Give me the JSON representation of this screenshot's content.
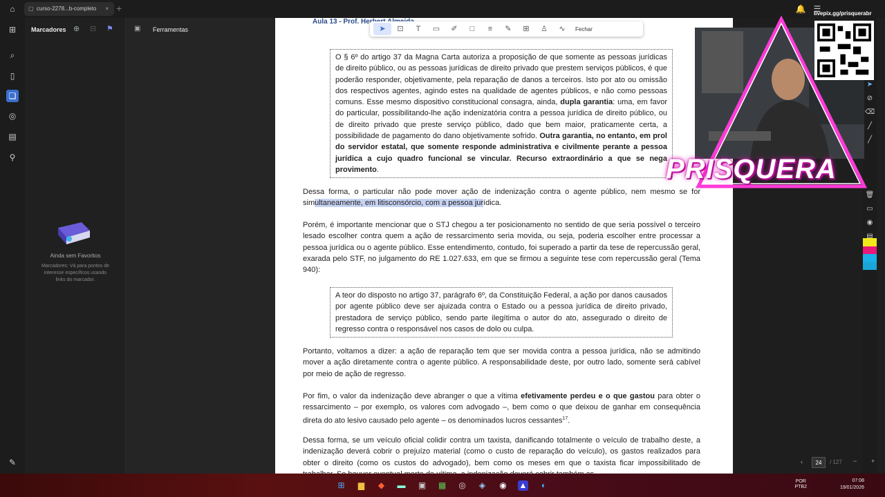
{
  "window": {
    "tab_title": "curso-2278...b-completo"
  },
  "bookmarks": {
    "title": "Marcadores",
    "empty_title": "Ainda sem Favoritos",
    "empty_desc": "Marcadores: Vá para pontos de interesse específicos usando links do marcador."
  },
  "tools_panel": {
    "title": "Ferramentas"
  },
  "float_toolbar": {
    "close_label": "Fechar"
  },
  "doc": {
    "header": "Aula 13 - Prof. Herbert Almeida",
    "box1_pre": "O § 6º do artigo 37 da Magna Carta autoriza a proposição de que somente as pessoas jurídicas de direito público, ou as pessoas jurídicas de direito privado que prestem serviços públicos, é que poderão responder, objetivamente, pela reparação de danos a terceiros. Isto por ato ou omissão dos respectivos agentes, agindo estes na qualidade de agentes públicos, e não como pessoas comuns. Esse mesmo dispositivo constitucional consagra, ainda, ",
    "box1_bold1": "dupla garantia",
    "box1_mid": ": uma, em favor do particular, possibilitando-lhe ação indenizatória contra a pessoa jurídica de direito público, ou de direito privado que preste serviço público, dado que bem maior, praticamente certa, a possibilidade de pagamento do dano objetivamente sofrido. ",
    "box1_bold2": "Outra garantia, no entanto, em prol do servidor estatal, que somente responde administrativa e civilmente perante a pessoa jurídica a cujo quadro funcional se vincular. Recurso extraordinário a que se nega provimento",
    "box1_end": ".",
    "p1_pre": "Dessa forma, o particular não pode mover ação de indenização contra o agente público, nem mesmo se for sim",
    "p1_sel": "ultaneamente, em litisconsórcio, com a pessoa jur",
    "p1_post": "ídica.",
    "p2": "Porém, é importante mencionar que o STJ chegou a ter posicionamento no sentido de que seria possível o terceiro lesado escolher contra quem a ação de ressarcimento seria movida, ou seja, poderia escolher entre processar a pessoa jurídica ou o agente público. Esse entendimento, contudo, foi superado a partir da tese de repercussão geral, exarada pelo STF, no julgamento do RE 1.027.633, em que se firmou a seguinte tese com repercussão geral (Tema 940):",
    "box2": "A teor do disposto no artigo 37, parágrafo 6º, da Constituição Federal, a ação por danos causados por agente público deve ser ajuizada contra o Estado ou a pessoa jurídica de direito privado, prestadora de serviço público, sendo parte ilegítima o autor do ato, assegurado o direito de regresso contra o responsável nos casos de dolo ou culpa.",
    "p3": "Portanto, voltamos a dizer: a ação de reparação tem que ser movida contra a pessoa jurídica, não se admitindo mover a ação diretamente contra o agente público. A responsabilidade deste, por outro lado, somente será cabível por meio de ação de regresso.",
    "p4_pre": "Por fim, o valor da indenização deve abranger o que a vítima ",
    "p4_bold": "efetivamente perdeu e o que gastou",
    "p4_post": " para obter o ressarcimento – por exemplo, os valores com advogado –, bem como o que deixou de ganhar em consequência direta do ato lesivo causado pelo agente – os denominados lucros cessantes",
    "p4_sup": "17",
    "p4_end": ".",
    "p5": "Dessa forma, se um veículo oficial colidir contra um taxista, danificando totalmente o veículo de trabalho deste, a indenização deverá cobrir o prejuízo material (como o custo de reparação do veículo), os gastos realizados para obter o direito (como os custos do advogado), bem como os meses em que o taxista ficar impossibilitado de trabalhar. Se houver eventual morte da vítima, a indenização deverá cobrir também as"
  },
  "pager": {
    "current": "24",
    "total": "/ 127"
  },
  "overlay": {
    "brand": "PRISQUERA",
    "handle": "livepix.gg/prisquerabr"
  },
  "taskbar": {
    "lang1": "POR",
    "lang2": "PTB2",
    "time": "07:08",
    "date": "19/01/2026"
  }
}
